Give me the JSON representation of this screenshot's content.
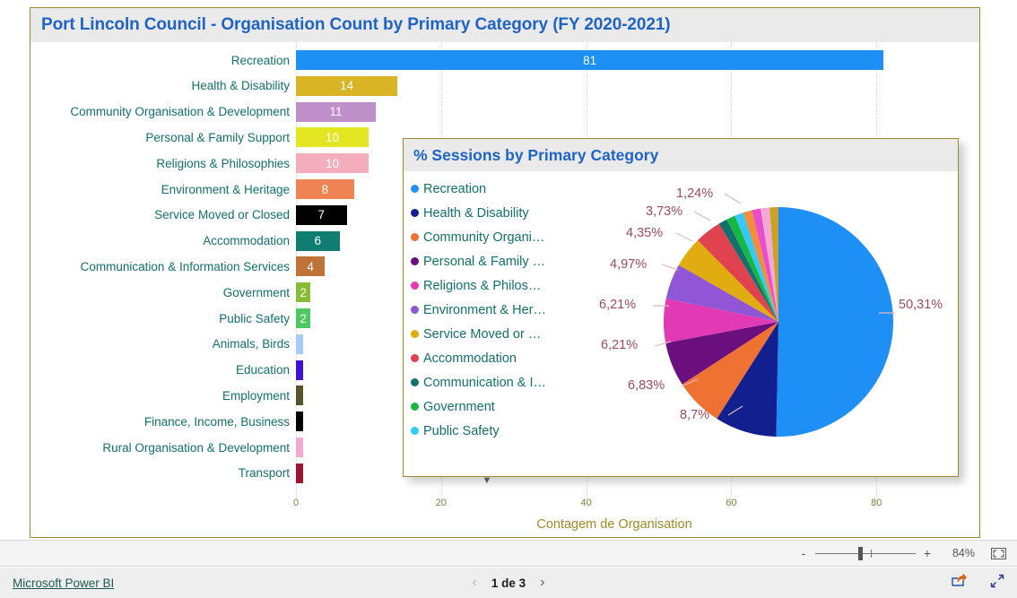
{
  "bar_visual": {
    "title": "Port Lincoln Council - Organisation Count by Primary Category (FY 2020-2021)",
    "x_axis_title": "Contagem de Organisation"
  },
  "pie_visual": {
    "title": "% Sessions by Primary Category",
    "more_icon": "chevron-down-icon"
  },
  "zoom_bar": {
    "minus_label": "-",
    "plus_label": "+",
    "percent": "84%",
    "fit_icon": "fit-to-page-icon"
  },
  "footer": {
    "brand_link": "Microsoft Power BI",
    "prev_label": "‹",
    "next_label": "›",
    "page_label": "1 de 3",
    "share_icon": "share-icon",
    "fullscreen_icon": "fullscreen-icon"
  },
  "chart_data": [
    {
      "type": "bar",
      "title": "Port Lincoln Council - Organisation Count by Primary Category (FY 2020-2021)",
      "orientation": "horizontal",
      "xlabel": "Contagem de Organisation",
      "ylabel": "",
      "xlim": [
        0,
        88
      ],
      "xticks": [
        0,
        20,
        40,
        60,
        80
      ],
      "grid": true,
      "categories": [
        "Recreation",
        "Health & Disability",
        "Community Organisation & Development",
        "Personal & Family Support",
        "Religions & Philosophies",
        "Environment & Heritage",
        "Service Moved or Closed",
        "Accommodation",
        "Communication & Information Services",
        "Government",
        "Public Safety",
        "Animals, Birds",
        "Education",
        "Employment",
        "Finance, Income, Business",
        "Rural Organisation & Development",
        "Transport"
      ],
      "values": [
        81,
        14,
        11,
        10,
        10,
        8,
        7,
        6,
        4,
        2,
        2,
        1,
        1,
        1,
        1,
        1,
        1
      ],
      "value_labels": [
        "81",
        "14",
        "11",
        "10",
        "10",
        "8",
        "7",
        "6",
        "4",
        "2",
        "2",
        "",
        "",
        "",
        "",
        "",
        ""
      ],
      "colors": [
        "#1e90f5",
        "#d9b526",
        "#bf8fc9",
        "#e2e520",
        "#f4aebb",
        "#ef8354",
        "#000000",
        "#0f7d72",
        "#bf7339",
        "#86bc36",
        "#4ec860",
        "#a6cdf5",
        "#4112cf",
        "#57542c",
        "#000000",
        "#f2a9d4",
        "#9c1430"
      ]
    },
    {
      "type": "pie",
      "title": "% Sessions by Primary Category",
      "legend_position": "left",
      "labels": [
        "Recreation",
        "Health & Disability",
        "Community Organi…",
        "Personal & Family …",
        "Religions & Philos…",
        "Environment & Her…",
        "Service Moved or …",
        "Accommodation",
        "Communication & I…",
        "Government",
        "Public Safety"
      ],
      "legend_colors": [
        "#1e90f5",
        "#121f8f",
        "#ef7233",
        "#6b0f7e",
        "#e23ab5",
        "#9056d6",
        "#e0ac10",
        "#e0424f",
        "#14706e",
        "#17b743",
        "#37c9f5"
      ],
      "slice_colors": [
        "#1e90f5",
        "#121f8f",
        "#ef7233",
        "#6b0f7e",
        "#e23ab5",
        "#9056d6",
        "#e0ac10",
        "#e0424f",
        "#14706e",
        "#17b743",
        "#37c9f5",
        "#f28e3a",
        "#e84ecb",
        "#f2a9d4",
        "#c9a227"
      ],
      "values": [
        50.31,
        8.7,
        6.83,
        6.21,
        6.21,
        4.97,
        4.35,
        3.73,
        1.24,
        1.24,
        1.24,
        1.24,
        1.24,
        1.24,
        1.24
      ],
      "visible_labels": [
        "50,31%",
        "8,7%",
        "6,83%",
        "6,21%",
        "6,21%",
        "4,97%",
        "4,35%",
        "3,73%",
        "1,24%"
      ],
      "unit": "%"
    }
  ]
}
